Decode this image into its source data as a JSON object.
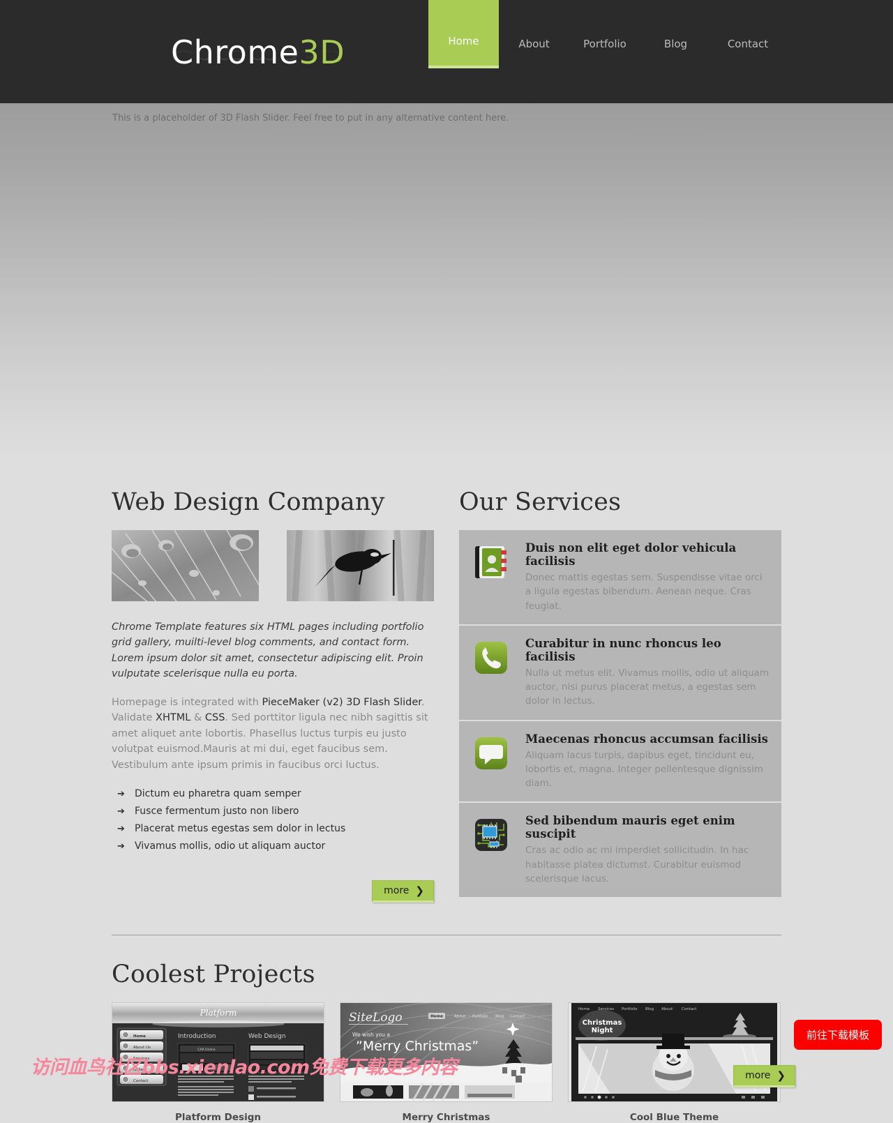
{
  "header": {
    "logo": {
      "primary": "Chrome",
      "accent": "3D"
    },
    "accent_color": "#a9cc55",
    "background_color": "#2b2b2b",
    "nav": [
      {
        "label": "Home",
        "active": true
      },
      {
        "label": "About",
        "active": false
      },
      {
        "label": "Portfolio",
        "active": false
      },
      {
        "label": "Blog",
        "active": false
      },
      {
        "label": "Contact",
        "active": false
      }
    ]
  },
  "slider": {
    "placeholder_text": "This is a placeholder of 3D Flash Slider. Feel free to put in any alternative content here."
  },
  "about": {
    "title": "Web Design Company",
    "images": [
      {
        "alt_name": "water-droplets-photo"
      },
      {
        "alt_name": "blackbird-on-branch-photo"
      }
    ],
    "lead": "Chrome Template features six HTML pages including portfolio grid gallery, muilti-level blog comments, and contact form. Lorem ipsum dolor sit amet, consectetur adipiscing elit. Proin vulputate scelerisque nulla eu porta.",
    "body_parts": [
      {
        "text": "Homepage is integrated with ",
        "link": false
      },
      {
        "text": "PieceMaker (v2) 3D Flash Slider",
        "link": true
      },
      {
        "text": ". Validate ",
        "link": false
      },
      {
        "text": "XHTML",
        "link": true
      },
      {
        "text": " & ",
        "link": false
      },
      {
        "text": "CSS",
        "link": true
      },
      {
        "text": ". Sed porttitor ligula nec nibh sagittis sit amet aliquet ante lobortis. Phasellus luctus turpis eu justo volutpat euismod.Mauris at mi dui, eget faucibus sem. Vestibulum ante ipsum primis in faucibus orci luctus.",
        "link": false
      }
    ],
    "bullets": [
      "Dictum eu pharetra quam semper",
      "Fusce fermentum justo non libero",
      "Placerat metus egestas sem dolor in lectus",
      "Vivamus mollis, odio ut aliquam auctor"
    ],
    "more_label": "more"
  },
  "services": {
    "title": "Our Services",
    "items": [
      {
        "icon": "address-book-icon",
        "title": "Duis non elit eget dolor vehicula facilisis",
        "desc": "Donec mattis egestas sem.  Suspendisse vitae orci a ligula egestas bibendum. Aenean neque. Cras feugiat."
      },
      {
        "icon": "phone-icon",
        "title": "Curabitur in nunc rhoncus leo facilisis",
        "desc": "Nulla ut metus elit. Vivamus mollis, odio ut aliquam auctor, nisi purus placerat metus, a egestas sem dolor in lectus."
      },
      {
        "icon": "speech-bubble-icon",
        "title": "Maecenas rhoncus accumsan facilisis",
        "desc": "Aliquam lacus turpis, dapibus eget, tincidunt eu, lobortis et, magna. Integer pellentesque dignissim diam."
      },
      {
        "icon": "circuit-chip-icon",
        "title": "Sed bibendum mauris eget enim suscipit",
        "desc": "Cras ac odio ac mi imperdiet sollicitudin. In hac habitasse platea dictumst. Curabitur euismod scelerisque lacus."
      }
    ]
  },
  "projects": {
    "title": "Coolest Projects",
    "items": [
      {
        "caption": "Platform Design",
        "shot": {
          "brand": "Platform",
          "nav": [
            "Home",
            "About Us",
            "Services",
            "Gallery",
            "Contact"
          ],
          "col1": "Introduction",
          "col2": "Web Design",
          "inner_label": "CAR Online"
        }
      },
      {
        "caption": "Merry Christmas",
        "shot": {
          "brand": "SiteLogo",
          "nav": [
            "Home",
            "About",
            "Portfolio",
            "Blog",
            "Contact"
          ],
          "line1": "We wish you a",
          "line2": "“Merry Christmas”"
        }
      },
      {
        "caption": "Cool Blue Theme",
        "shot": {
          "nav": [
            "Home",
            "Services",
            "Portfolio",
            "Blog",
            "About",
            "Contact"
          ],
          "badge_line1": "Christmas",
          "badge_line2": "Night"
        }
      }
    ],
    "more_label": "more"
  },
  "watermark": {
    "text": "访问血鸟社区bbs.xienlao.com免费下载更多内容",
    "color": "#f5879c"
  },
  "cta": {
    "label": "前往下载模板",
    "color": "#fc0000"
  }
}
